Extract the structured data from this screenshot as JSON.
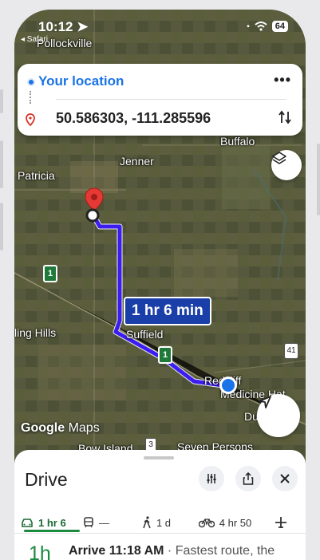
{
  "status_bar": {
    "time": "10:12",
    "back_app": "◂ Safari",
    "battery": "64"
  },
  "route_card": {
    "origin": "Your location",
    "destination": "50.586303, -111.285596"
  },
  "map": {
    "places": {
      "pollockville": "Pollockville",
      "buffalo": "Buffalo",
      "jenner": "Jenner",
      "patricia": "Patricia",
      "rolling_hills": "ling Hills",
      "suffield": "Suffield",
      "redcliff": "Redcliff",
      "medicine_hat": "Medicine Hat",
      "dunmore": "Du",
      "bow_island": "Bow Island",
      "seven_persons": "Seven Persons"
    },
    "highway_1": "1",
    "highway_41": "41",
    "highway_3": "3",
    "eta_label": "1 hr 6 min",
    "attribution_brand": "Google",
    "attribution_product": "Maps"
  },
  "sheet": {
    "title": "Drive",
    "modes": [
      {
        "name": "drive",
        "label": "1 hr 6"
      },
      {
        "name": "transit",
        "label": "—"
      },
      {
        "name": "walk",
        "label": "1 d"
      },
      {
        "name": "bike",
        "label": "4 hr 50"
      },
      {
        "name": "flight",
        "label": ""
      }
    ],
    "result": {
      "duration": "1h",
      "arrive": "Arrive 11:18 AM",
      "note": " · Fastest route, the"
    }
  },
  "colors": {
    "route": "#3b1df0",
    "accent_blue": "#1a73e8",
    "accent_green": "#1a8a3f"
  }
}
